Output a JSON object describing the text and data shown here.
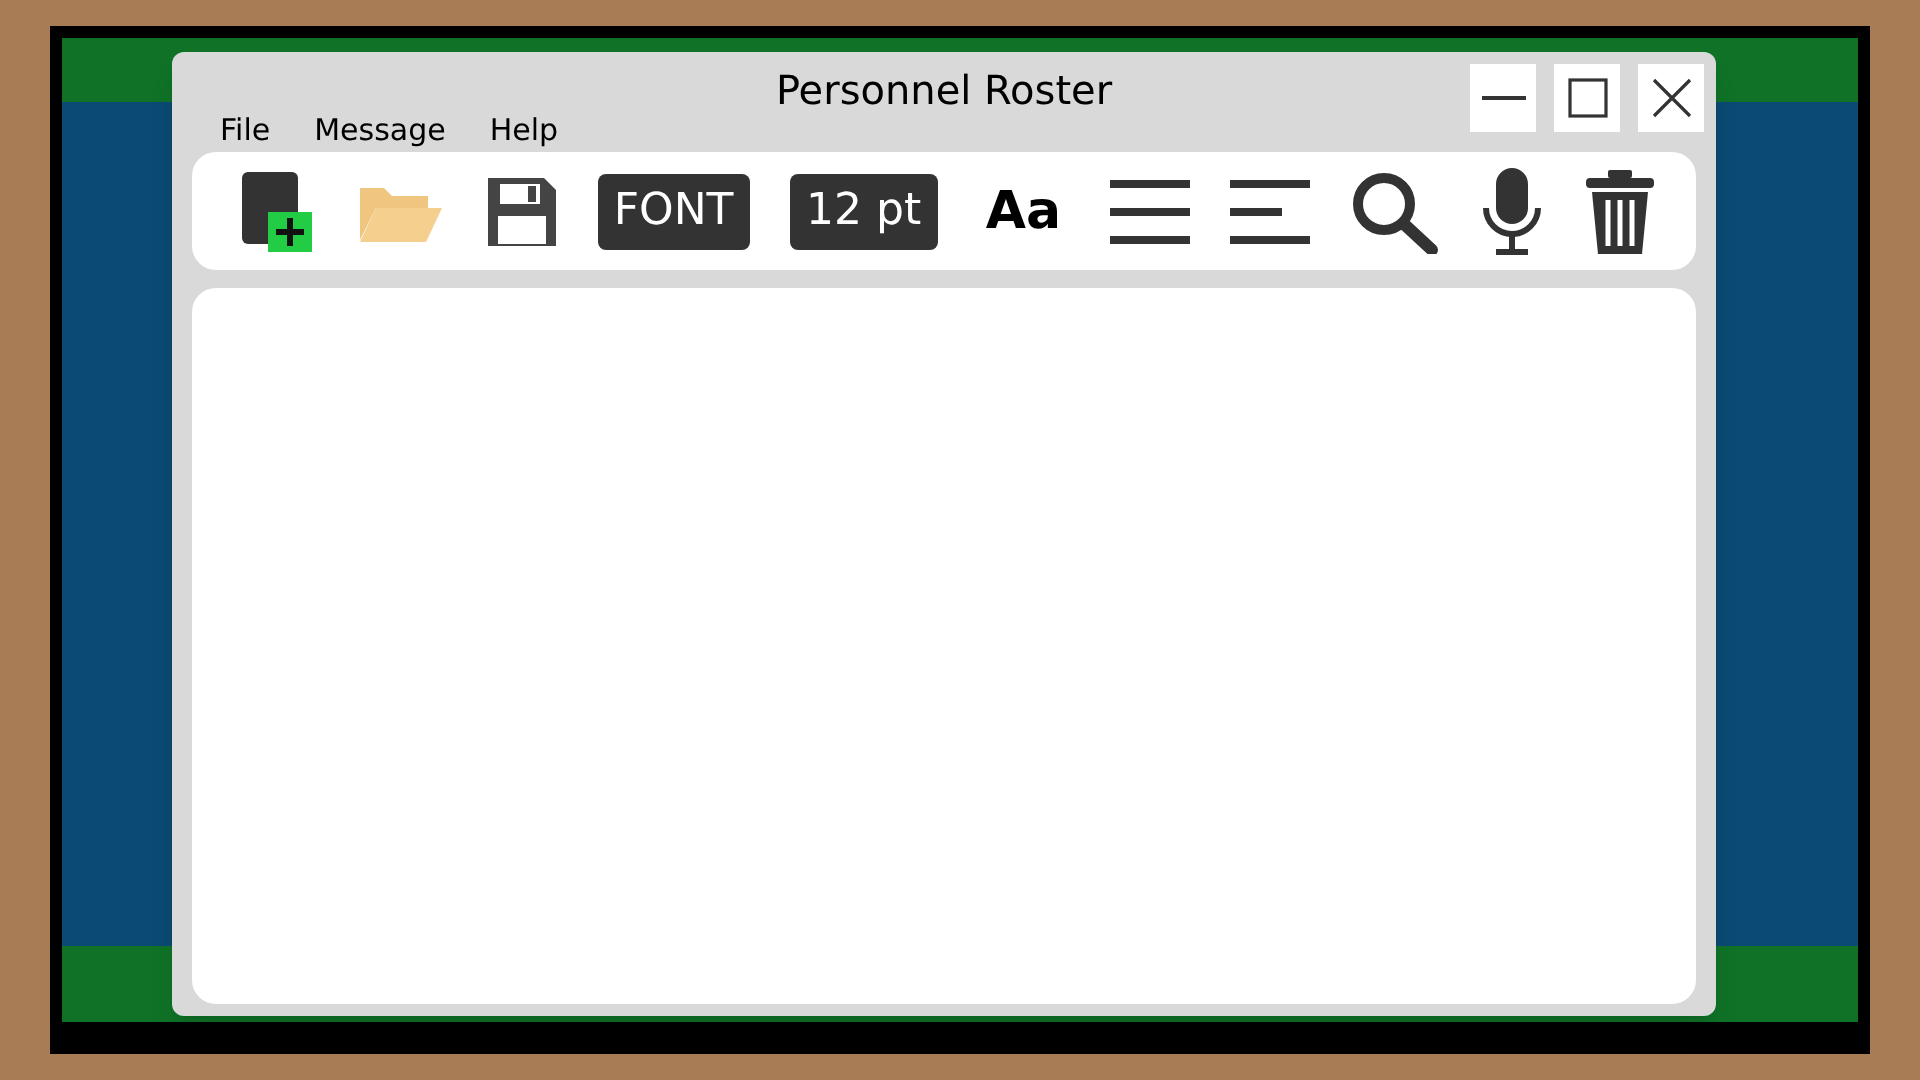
{
  "window": {
    "title": "Personnel Roster"
  },
  "menu": [
    "File",
    "Message",
    "Help"
  ],
  "toolbar": {
    "text_items": [
      {
        "kind": "label",
        "text": "FONT"
      },
      {
        "kind": "label",
        "text": "12 pt"
      },
      {
        "kind": "glyph",
        "text": "Aa"
      }
    ]
  }
}
